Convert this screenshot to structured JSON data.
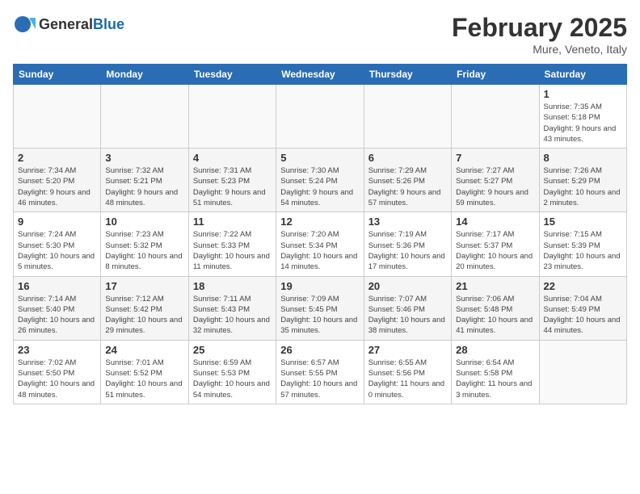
{
  "header": {
    "logo": {
      "general": "General",
      "blue": "Blue"
    },
    "title": "February 2025",
    "subtitle": "Mure, Veneto, Italy"
  },
  "weekdays": [
    "Sunday",
    "Monday",
    "Tuesday",
    "Wednesday",
    "Thursday",
    "Friday",
    "Saturday"
  ],
  "weeks": [
    [
      {
        "day": "",
        "info": ""
      },
      {
        "day": "",
        "info": ""
      },
      {
        "day": "",
        "info": ""
      },
      {
        "day": "",
        "info": ""
      },
      {
        "day": "",
        "info": ""
      },
      {
        "day": "",
        "info": ""
      },
      {
        "day": "1",
        "info": "Sunrise: 7:35 AM\nSunset: 5:18 PM\nDaylight: 9 hours and 43 minutes."
      }
    ],
    [
      {
        "day": "2",
        "info": "Sunrise: 7:34 AM\nSunset: 5:20 PM\nDaylight: 9 hours and 46 minutes."
      },
      {
        "day": "3",
        "info": "Sunrise: 7:32 AM\nSunset: 5:21 PM\nDaylight: 9 hours and 48 minutes."
      },
      {
        "day": "4",
        "info": "Sunrise: 7:31 AM\nSunset: 5:23 PM\nDaylight: 9 hours and 51 minutes."
      },
      {
        "day": "5",
        "info": "Sunrise: 7:30 AM\nSunset: 5:24 PM\nDaylight: 9 hours and 54 minutes."
      },
      {
        "day": "6",
        "info": "Sunrise: 7:29 AM\nSunset: 5:26 PM\nDaylight: 9 hours and 57 minutes."
      },
      {
        "day": "7",
        "info": "Sunrise: 7:27 AM\nSunset: 5:27 PM\nDaylight: 9 hours and 59 minutes."
      },
      {
        "day": "8",
        "info": "Sunrise: 7:26 AM\nSunset: 5:29 PM\nDaylight: 10 hours and 2 minutes."
      }
    ],
    [
      {
        "day": "9",
        "info": "Sunrise: 7:24 AM\nSunset: 5:30 PM\nDaylight: 10 hours and 5 minutes."
      },
      {
        "day": "10",
        "info": "Sunrise: 7:23 AM\nSunset: 5:32 PM\nDaylight: 10 hours and 8 minutes."
      },
      {
        "day": "11",
        "info": "Sunrise: 7:22 AM\nSunset: 5:33 PM\nDaylight: 10 hours and 11 minutes."
      },
      {
        "day": "12",
        "info": "Sunrise: 7:20 AM\nSunset: 5:34 PM\nDaylight: 10 hours and 14 minutes."
      },
      {
        "day": "13",
        "info": "Sunrise: 7:19 AM\nSunset: 5:36 PM\nDaylight: 10 hours and 17 minutes."
      },
      {
        "day": "14",
        "info": "Sunrise: 7:17 AM\nSunset: 5:37 PM\nDaylight: 10 hours and 20 minutes."
      },
      {
        "day": "15",
        "info": "Sunrise: 7:15 AM\nSunset: 5:39 PM\nDaylight: 10 hours and 23 minutes."
      }
    ],
    [
      {
        "day": "16",
        "info": "Sunrise: 7:14 AM\nSunset: 5:40 PM\nDaylight: 10 hours and 26 minutes."
      },
      {
        "day": "17",
        "info": "Sunrise: 7:12 AM\nSunset: 5:42 PM\nDaylight: 10 hours and 29 minutes."
      },
      {
        "day": "18",
        "info": "Sunrise: 7:11 AM\nSunset: 5:43 PM\nDaylight: 10 hours and 32 minutes."
      },
      {
        "day": "19",
        "info": "Sunrise: 7:09 AM\nSunset: 5:45 PM\nDaylight: 10 hours and 35 minutes."
      },
      {
        "day": "20",
        "info": "Sunrise: 7:07 AM\nSunset: 5:46 PM\nDaylight: 10 hours and 38 minutes."
      },
      {
        "day": "21",
        "info": "Sunrise: 7:06 AM\nSunset: 5:48 PM\nDaylight: 10 hours and 41 minutes."
      },
      {
        "day": "22",
        "info": "Sunrise: 7:04 AM\nSunset: 5:49 PM\nDaylight: 10 hours and 44 minutes."
      }
    ],
    [
      {
        "day": "23",
        "info": "Sunrise: 7:02 AM\nSunset: 5:50 PM\nDaylight: 10 hours and 48 minutes."
      },
      {
        "day": "24",
        "info": "Sunrise: 7:01 AM\nSunset: 5:52 PM\nDaylight: 10 hours and 51 minutes."
      },
      {
        "day": "25",
        "info": "Sunrise: 6:59 AM\nSunset: 5:53 PM\nDaylight: 10 hours and 54 minutes."
      },
      {
        "day": "26",
        "info": "Sunrise: 6:57 AM\nSunset: 5:55 PM\nDaylight: 10 hours and 57 minutes."
      },
      {
        "day": "27",
        "info": "Sunrise: 6:55 AM\nSunset: 5:56 PM\nDaylight: 11 hours and 0 minutes."
      },
      {
        "day": "28",
        "info": "Sunrise: 6:54 AM\nSunset: 5:58 PM\nDaylight: 11 hours and 3 minutes."
      },
      {
        "day": "",
        "info": ""
      }
    ]
  ]
}
